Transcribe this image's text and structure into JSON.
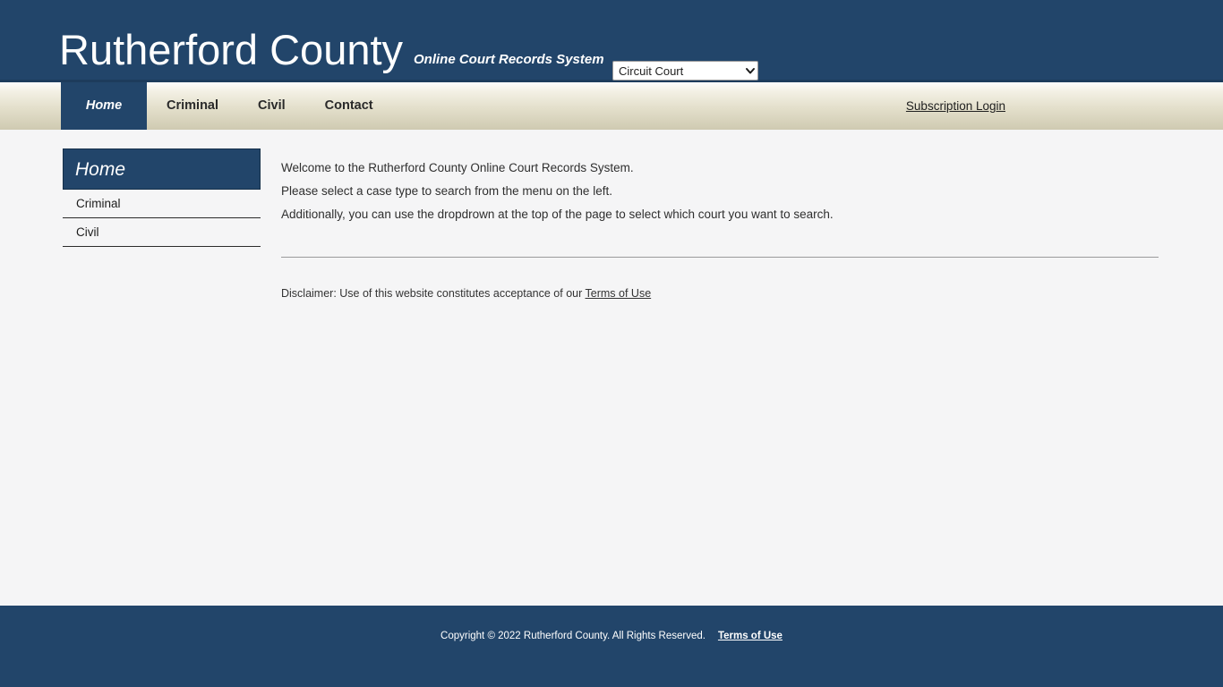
{
  "header": {
    "brand_title": "Rutherford County",
    "tagline": "Online Court Records System",
    "court_select": {
      "name": "court-selector",
      "selected": "Circuit Court",
      "options": [
        "Circuit Court"
      ],
      "arrow_icon": "chevron-down-icon"
    },
    "background_color": "#22456a"
  },
  "nav": {
    "items": [
      {
        "label": "Home",
        "active": true
      },
      {
        "label": "Criminal",
        "active": false
      },
      {
        "label": "Civil",
        "active": false
      },
      {
        "label": "Contact",
        "active": false
      }
    ],
    "subscription_login": "Subscription Login"
  },
  "sidebar": {
    "header": "Home",
    "items": [
      {
        "label": "Criminal"
      },
      {
        "label": "Civil"
      }
    ]
  },
  "main": {
    "lines": [
      "Welcome to the Rutherford County Online Court Records System.",
      "Please select a case type to search from the menu on the left.",
      "Additionally, you can use the dropdrown at the top of the page to select which court you want to search."
    ],
    "disclaimer_prefix": "Disclaimer: Use of this website constitutes acceptance of our ",
    "disclaimer_link": "Terms of Use"
  },
  "footer": {
    "copyright": "Copyright © 2022 Rutherford County. All Rights Reserved.",
    "terms_link": "Terms of Use",
    "background_color": "#22456a"
  }
}
